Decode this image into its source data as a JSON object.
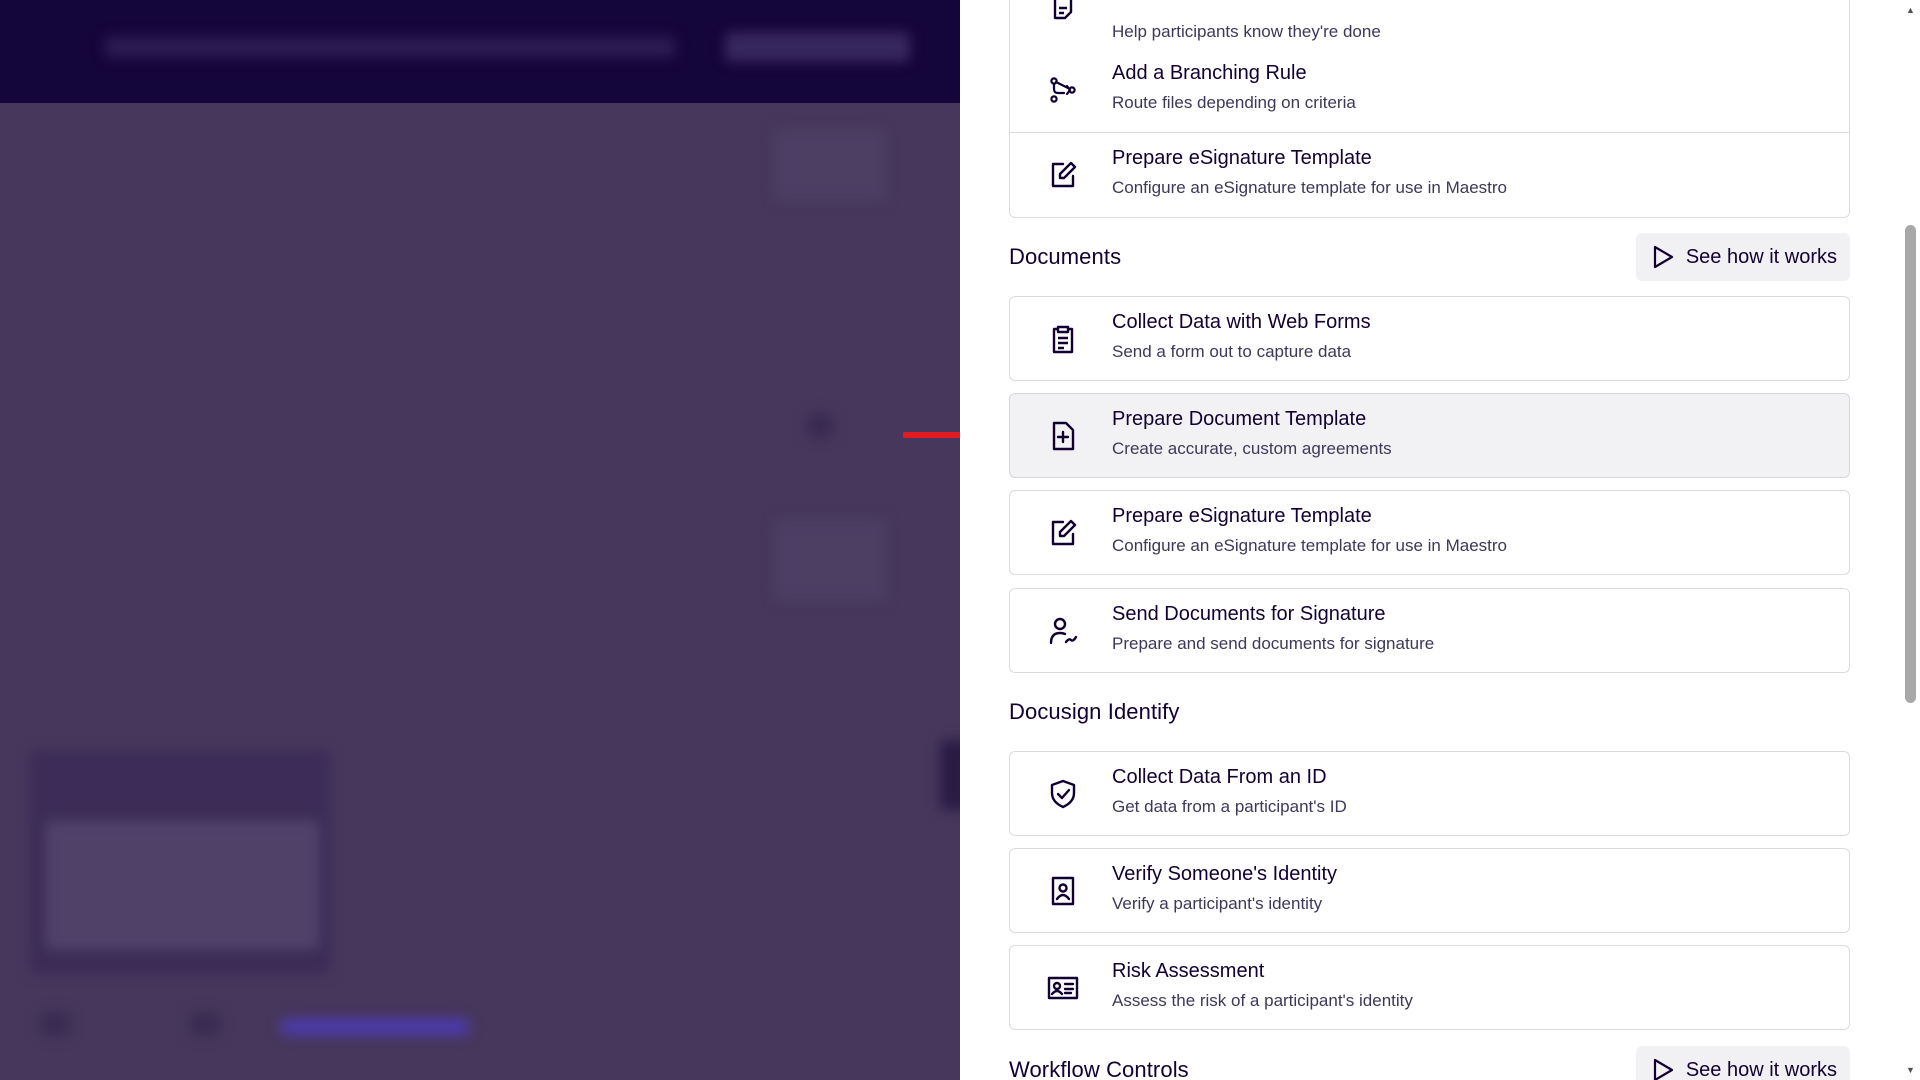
{
  "panel": {
    "top_partial_card": {
      "title": "",
      "desc": "Help participants know they're done",
      "icon": "document-check-icon"
    },
    "cards_top": [
      {
        "title": "Add a Branching Rule",
        "desc": "Route files depending on criteria",
        "icon": "branch-icon"
      },
      {
        "title": "Prepare eSignature Template",
        "desc": "Configure an eSignature template for use in Maestro",
        "icon": "edit-document-icon"
      }
    ],
    "see_how_label": "See how it works",
    "documents": {
      "title": "Documents",
      "cards": [
        {
          "title": "Collect Data with Web Forms",
          "desc": "Send a form out to capture data",
          "icon": "clipboard-icon"
        },
        {
          "title": "Prepare Document Template",
          "desc": "Create accurate, custom agreements",
          "icon": "document-plus-icon"
        },
        {
          "title": "Prepare eSignature Template",
          "desc": "Configure an eSignature template for use in Maestro",
          "icon": "edit-document-icon"
        },
        {
          "title": "Send Documents for Signature",
          "desc": "Prepare and send documents for signature",
          "icon": "person-sign-icon"
        }
      ]
    },
    "identify": {
      "title": "Docusign Identify",
      "cards": [
        {
          "title": "Collect Data From an ID",
          "desc": "Get data from a participant's ID",
          "icon": "shield-check-icon"
        },
        {
          "title": "Verify Someone's Identity",
          "desc": "Verify a participant's identity",
          "icon": "id-badge-icon"
        },
        {
          "title": "Risk Assessment",
          "desc": "Assess the risk of a participant's identity",
          "icon": "id-card-icon"
        }
      ]
    },
    "workflow_controls": {
      "title": "Workflow Controls"
    }
  },
  "colors": {
    "text_primary": "#130032",
    "overlay": "#47375c",
    "topbar": "#14053a",
    "arrow": "#e31b23",
    "highlight_card": "#f2f2f4"
  }
}
